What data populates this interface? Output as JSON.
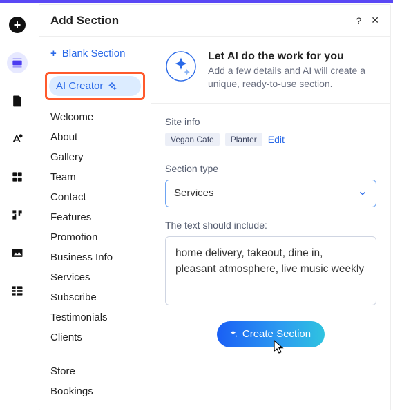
{
  "panel": {
    "title": "Add Section",
    "help": "?",
    "close": "✕"
  },
  "blank_section": "Blank Section",
  "sidebar": {
    "ai_creator": "AI Creator",
    "items": [
      "Welcome",
      "About",
      "Gallery",
      "Team",
      "Contact",
      "Features",
      "Promotion",
      "Business Info",
      "Services",
      "Subscribe",
      "Testimonials",
      "Clients"
    ],
    "more": [
      "Store",
      "Bookings"
    ]
  },
  "intro": {
    "title": "Let AI do the work for you",
    "desc": "Add a few details and AI will create a unique, ready-to-use section."
  },
  "site_info": {
    "label": "Site info",
    "chips": [
      "Vegan Cafe",
      "Planter"
    ],
    "edit": "Edit"
  },
  "section_type": {
    "label": "Section type",
    "value": "Services"
  },
  "text_include": {
    "label": "The text should include:",
    "value": "home delivery, takeout, dine in, pleasant atmosphere, live music weekly"
  },
  "cta": "Create Section"
}
